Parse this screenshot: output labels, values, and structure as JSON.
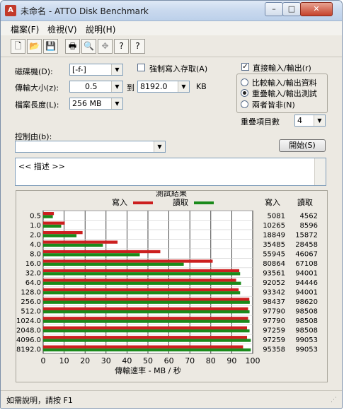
{
  "window": {
    "title": "未命名 - ATTO Disk Benchmark",
    "btn_min": "–",
    "btn_max": "□",
    "btn_close": "✕"
  },
  "menu": [
    "檔案(F)",
    "檢視(V)",
    "說明(H)"
  ],
  "toolbar": {
    "icons": [
      "new-file-icon",
      "open-folder-icon",
      "save-icon",
      "print-icon",
      "print-preview-icon",
      "move-icon",
      "help-icon",
      "context-help-icon"
    ],
    "glyphs": [
      "🗋",
      "📂",
      "💾",
      "🖶",
      "🔍",
      "✥",
      "?",
      "?"
    ]
  },
  "form": {
    "drive_label": "磁碟機(D):",
    "drive_value": "[-f-]",
    "force_write_label": "強制寫入存取(A)",
    "force_write_checked": false,
    "direct_io_label": "直接輸入/輸出(r)",
    "direct_io_checked": true,
    "transfer_label": "傳輸大小(z):",
    "transfer_from": "0.5",
    "to_label": "到",
    "transfer_to": "8192.0",
    "kb_label": "KB",
    "length_label": "檔案長度(L):",
    "length_value": "256 MB",
    "radio_compare": "比較輸入/輸出資料",
    "radio_overlap": "重疊輸入/輸出測試",
    "radio_neither": "兩者皆非(N)",
    "queue_label": "重疊項目數",
    "queue_value": "4",
    "controlled_label": "控制由(b):",
    "controlled_value": "",
    "start_button": "開始(S)",
    "desc_text": "<<    描述    >>"
  },
  "status": {
    "text": "如需說明，請按 F1"
  },
  "colors": {
    "write": "#cc1f1f",
    "read": "#1a8a1a",
    "accent": "#3a6ea5"
  },
  "chart_data": {
    "type": "bar",
    "orientation": "horizontal",
    "title": "測試結果",
    "legend": [
      "寫入",
      "讀取"
    ],
    "legend_position": "top",
    "xlabel": "傳輸速率 - MB / 秒",
    "xlim": [
      0,
      100
    ],
    "xticks": [
      0,
      10,
      20,
      30,
      40,
      50,
      60,
      70,
      80,
      90,
      100
    ],
    "grid": true,
    "col_headers": [
      "寫入",
      "讀取"
    ],
    "categories": [
      "0.5",
      "1.0",
      "2.0",
      "4.0",
      "8.0",
      "16.0",
      "32.0",
      "64.0",
      "128.0",
      "256.0",
      "512.0",
      "1024.0",
      "2048.0",
      "4096.0",
      "8192.0"
    ],
    "series": [
      {
        "name": "寫入",
        "color": "#cc1f1f",
        "values": [
          5.1,
          10.3,
          18.8,
          35.5,
          55.9,
          80.9,
          93.6,
          92.1,
          93.3,
          98.4,
          97.8,
          97.8,
          97.3,
          97.3,
          95.4
        ],
        "labels": [
          "5081",
          "10265",
          "18849",
          "35485",
          "55945",
          "80864",
          "93561",
          "92052",
          "93342",
          "98437",
          "97790",
          "97790",
          "97259",
          "97259",
          "95358"
        ]
      },
      {
        "name": "讀取",
        "color": "#1a8a1a",
        "values": [
          4.6,
          8.6,
          15.9,
          28.5,
          46.1,
          67.1,
          94.0,
          94.4,
          94.0,
          98.6,
          98.5,
          98.5,
          98.5,
          99.1,
          99.1
        ],
        "labels": [
          "4562",
          "8596",
          "15872",
          "28458",
          "46067",
          "67108",
          "94001",
          "94446",
          "94001",
          "98620",
          "98508",
          "98508",
          "98508",
          "99053",
          "99053"
        ]
      }
    ]
  }
}
